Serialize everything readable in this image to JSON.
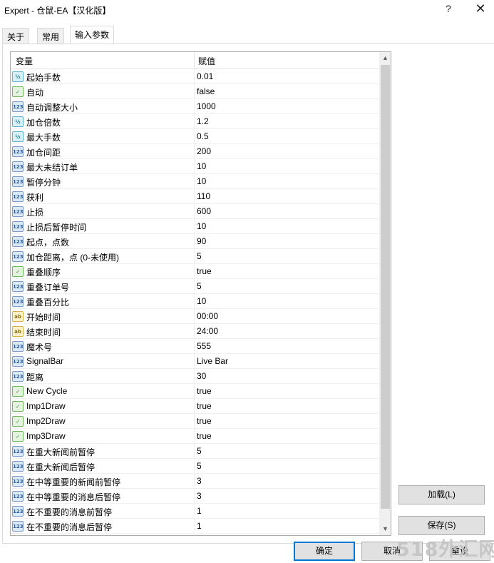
{
  "window": {
    "title": "Expert - 仓鼠-EA【汉化版】",
    "help_icon": "?",
    "close_icon": "✕"
  },
  "tabs": [
    {
      "label": "关于"
    },
    {
      "label": "常用"
    },
    {
      "label": "输入参数",
      "active": true
    }
  ],
  "grid": {
    "col_variable": "变量",
    "col_value": "赋值",
    "rows": [
      {
        "type": "double",
        "icon": "V/2",
        "name": "起始手数",
        "value": "0.01"
      },
      {
        "type": "bool",
        "icon": "bool",
        "name": "自动",
        "value": "false"
      },
      {
        "type": "int",
        "icon": "123",
        "name": "自动调整大小",
        "value": "1000"
      },
      {
        "type": "double",
        "icon": "V/2",
        "name": "加仓倍数",
        "value": "1.2"
      },
      {
        "type": "double",
        "icon": "V/2",
        "name": "最大手数",
        "value": "0.5"
      },
      {
        "type": "int",
        "icon": "123",
        "name": "加仓间距",
        "value": "200"
      },
      {
        "type": "int",
        "icon": "123",
        "name": "最大未结订单",
        "value": "10"
      },
      {
        "type": "int",
        "icon": "123",
        "name": "暂停分钟",
        "value": "10"
      },
      {
        "type": "int",
        "icon": "123",
        "name": "获利",
        "value": "110"
      },
      {
        "type": "int",
        "icon": "123",
        "name": "止损",
        "value": "600"
      },
      {
        "type": "int",
        "icon": "123",
        "name": "止损后暂停时间",
        "value": "10"
      },
      {
        "type": "int",
        "icon": "123",
        "name": "起点，点数",
        "value": "90"
      },
      {
        "type": "int",
        "icon": "123",
        "name": "加仓距离，点 (0-未使用)",
        "value": "5"
      },
      {
        "type": "bool",
        "icon": "bool",
        "name": "重叠顺序",
        "value": "true"
      },
      {
        "type": "int",
        "icon": "123",
        "name": "重叠订单号",
        "value": "5"
      },
      {
        "type": "int",
        "icon": "123",
        "name": "重叠百分比",
        "value": "10"
      },
      {
        "type": "string",
        "icon": "ab",
        "name": "开始时间",
        "value": "00:00"
      },
      {
        "type": "string",
        "icon": "ab",
        "name": "结束时间",
        "value": "24:00"
      },
      {
        "type": "int",
        "icon": "123",
        "name": "魔术号",
        "value": "555"
      },
      {
        "type": "int",
        "icon": "123",
        "name": "SignalBar",
        "value": "Live Bar"
      },
      {
        "type": "int",
        "icon": "123",
        "name": "距离",
        "value": "30"
      },
      {
        "type": "bool",
        "icon": "bool",
        "name": "New Cycle",
        "value": "true"
      },
      {
        "type": "bool",
        "icon": "bool",
        "name": "Imp1Draw",
        "value": "true"
      },
      {
        "type": "bool",
        "icon": "bool",
        "name": "Imp2Draw",
        "value": "true"
      },
      {
        "type": "bool",
        "icon": "bool",
        "name": "Imp3Draw",
        "value": "true"
      },
      {
        "type": "int",
        "icon": "123",
        "name": "在重大新闻前暂停",
        "value": "5"
      },
      {
        "type": "int",
        "icon": "123",
        "name": "在重大新闻后暂停",
        "value": "5"
      },
      {
        "type": "int",
        "icon": "123",
        "name": "在中等重要的新闻前暂停",
        "value": "3"
      },
      {
        "type": "int",
        "icon": "123",
        "name": "在中等重要的消息后暂停",
        "value": "3"
      },
      {
        "type": "int",
        "icon": "123",
        "name": "在不重要的消息前暂停",
        "value": "1"
      },
      {
        "type": "int",
        "icon": "123",
        "name": "在不重要的消息后暂停",
        "value": "1"
      }
    ]
  },
  "scrollbar": {
    "up_arrow": "▲",
    "down_arrow": "▼"
  },
  "buttons": {
    "load": "加载(L)",
    "save": "保存(S)",
    "ok": "确定",
    "cancel": "取消",
    "reset": "重设"
  },
  "watermark": "518外汇网"
}
